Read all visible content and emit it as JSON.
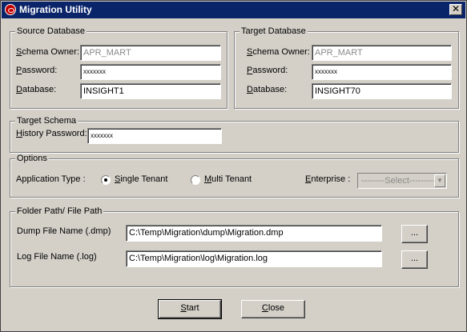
{
  "window": {
    "title": "Migration Utility",
    "close_glyph": "✕"
  },
  "source": {
    "legend": "Source Database",
    "schema_owner_label": "Schema Owner:",
    "schema_owner_value": "APR_MART",
    "password_label": "Password:",
    "password_value": "xxxxxxx",
    "database_label": "Database:",
    "database_value": "INSIGHT1"
  },
  "target": {
    "legend": "Target Database",
    "schema_owner_label": "Schema Owner:",
    "schema_owner_value": "APR_MART",
    "password_label": "Password:",
    "password_value": "xxxxxxx",
    "database_label": "Database:",
    "database_value": "INSIGHT70"
  },
  "target_schema": {
    "legend": "Target Schema",
    "history_password_label": "History Password:",
    "history_password_value": "xxxxxxx"
  },
  "options": {
    "legend": "Options",
    "app_type_label": "Application Type :",
    "single_tenant": "Single Tenant",
    "multi_tenant": "Multi Tenant",
    "selected": "Single Tenant",
    "enterprise_label": "Enterprise :",
    "enterprise_value": "--------Select---------"
  },
  "paths": {
    "legend": "Folder Path/ File Path",
    "dump_label": "Dump File Name (.dmp)",
    "dump_value": "C:\\Temp\\Migration\\dump\\Migration.dmp",
    "log_label": "Log File Name (.log)",
    "log_value": "C:\\Temp\\Migration\\log\\Migration.log",
    "browse_label": "..."
  },
  "buttons": {
    "start": "Start",
    "close": "Close"
  },
  "colors": {
    "titlebar": "#0a246a",
    "face": "#d4d0c8",
    "logo": "#c00000"
  }
}
